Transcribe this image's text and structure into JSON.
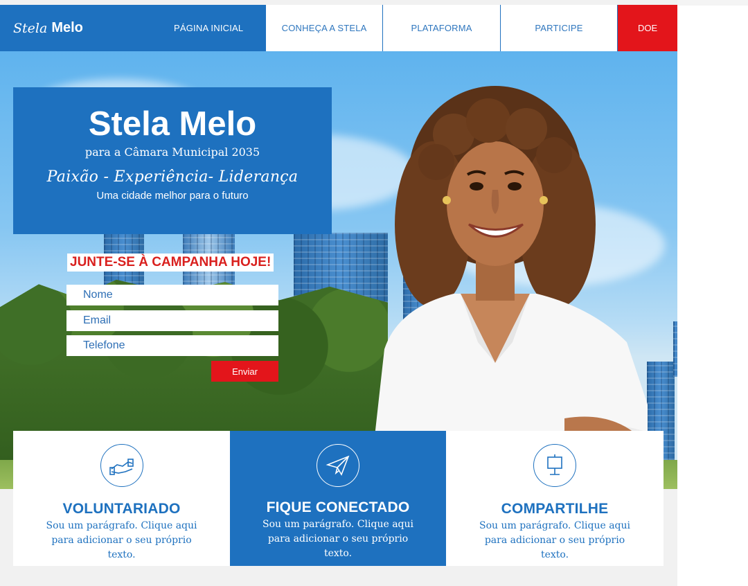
{
  "nav": {
    "brand_script": "Stela",
    "brand_bold": "Melo",
    "items": [
      "PÁGINA INICIAL",
      "CONHEÇA A STELA",
      "PLATAFORMA",
      "PARTICIPE"
    ],
    "donate": "DOE"
  },
  "hero": {
    "name": "Stela Melo",
    "subtitle": "para a Câmara Municipal 2035",
    "slogan": "Paixão - Experiência- Liderança",
    "tagline": "Uma cidade melhor para o futuro"
  },
  "form": {
    "heading": "JUNTE-SE À CAMPANHA HOJE!",
    "name_placeholder": "Nome",
    "email_placeholder": "Email",
    "phone_placeholder": "Telefone",
    "submit": "Enviar"
  },
  "cards": [
    {
      "title": "VOLUNTARIADO",
      "line1": "Sou um parágrafo. Clique aqui",
      "line2": "para adicionar o seu próprio texto.",
      "icon": "handshake-icon"
    },
    {
      "title": "FIQUE CONECTADO",
      "line1": "Sou um parágrafo. Clique aqui",
      "line2": "para adicionar o seu próprio texto.",
      "icon": "paper-plane-icon"
    },
    {
      "title": "COMPARTILHE",
      "line1": "Sou um parágrafo. Clique aqui",
      "line2": "para adicionar o seu próprio texto.",
      "icon": "sign-board-icon"
    }
  ],
  "colors": {
    "primary": "#1e71bf",
    "accent": "#e3151b",
    "background": "#f1f1f1"
  }
}
